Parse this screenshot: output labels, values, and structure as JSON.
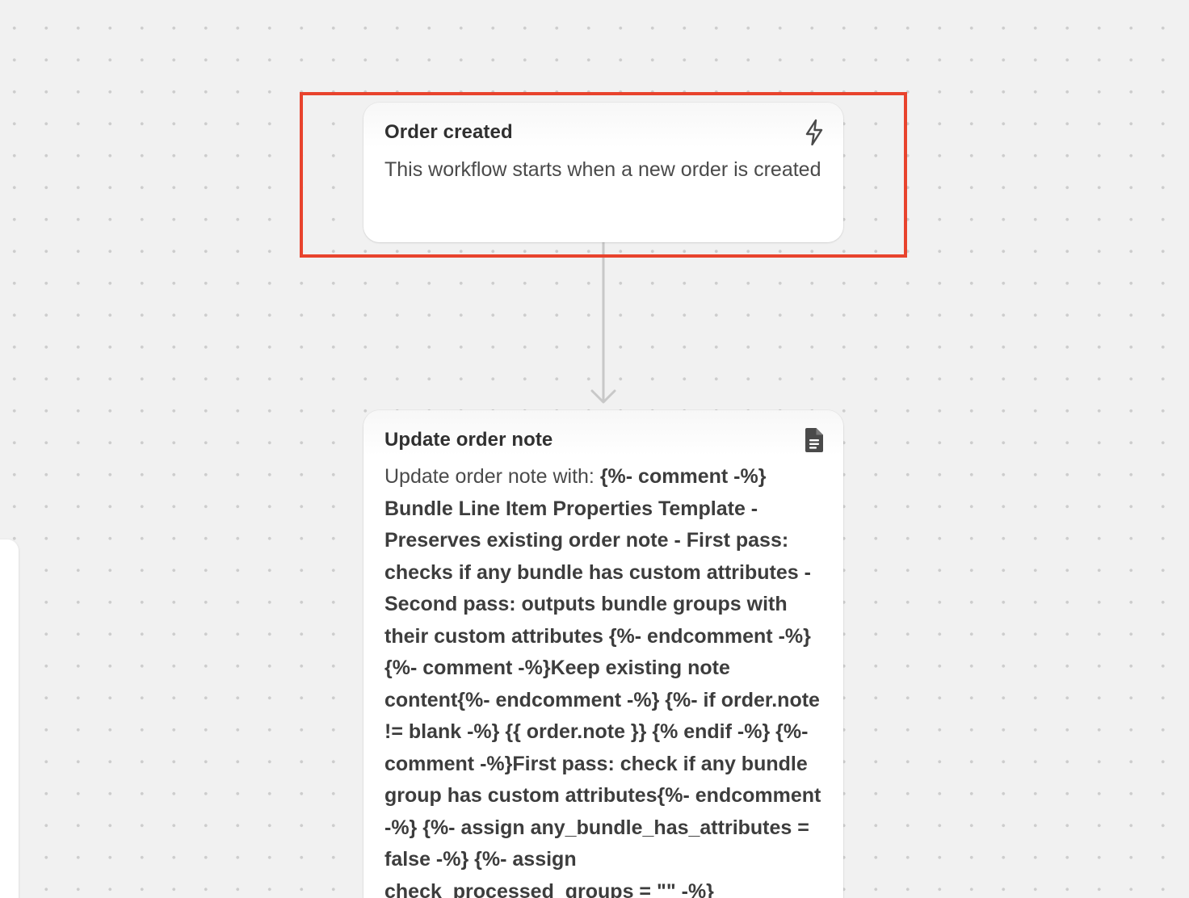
{
  "trigger_card": {
    "title": "Order created",
    "icon": "lightning-icon",
    "description": "This workflow starts when a new order is created"
  },
  "action_card": {
    "title": "Update order note",
    "icon": "document-icon",
    "prefix": "Update order note with: ",
    "value": "{%- comment -%} Bundle Line Item Properties Template - Preserves existing order note - First pass: checks if any bundle has custom attributes - Second pass: outputs bundle groups with their custom attributes {%- endcomment -%} {%- comment -%}Keep existing note content{%- endcomment -%} {%- if order.note != blank -%} {{ order.note }} {% endif -%} {%- comment -%}First pass: check if any bundle group has custom attributes{%- endcomment -%} {%- assign any_bundle_has_attributes = false -%} {%- assign check_processed_groups = \"\" -%}"
  },
  "colors": {
    "highlight": "#e8432d",
    "canvas": "#f1f1f1",
    "connector": "#c8c8c8"
  }
}
